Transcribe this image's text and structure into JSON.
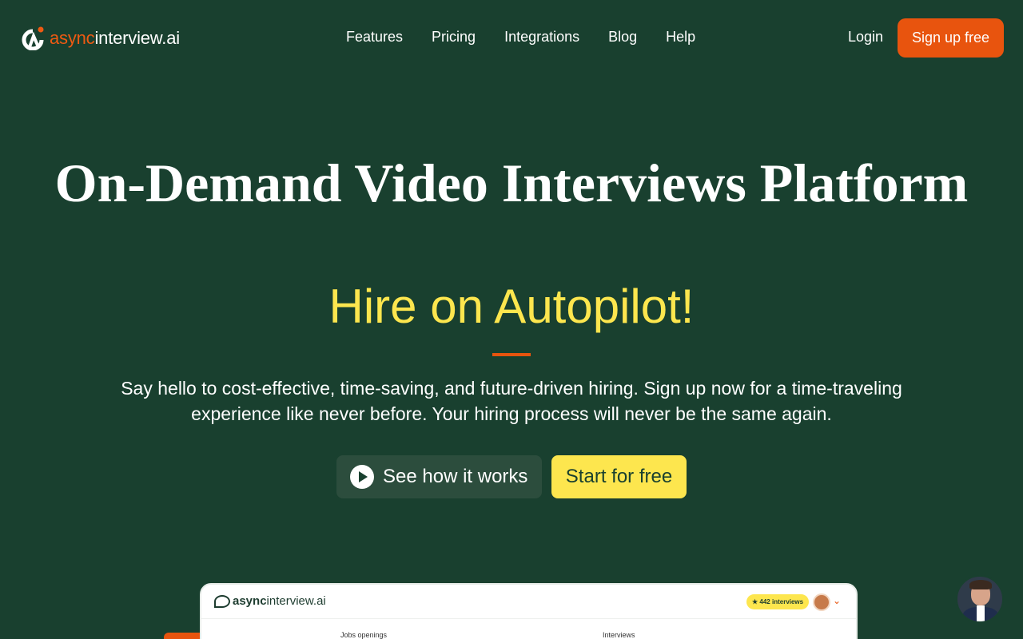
{
  "brand": {
    "part1": "async",
    "part2": "interview.ai"
  },
  "nav": {
    "links": [
      "Features",
      "Pricing",
      "Integrations",
      "Blog",
      "Help"
    ],
    "login": "Login",
    "signup": "Sign up free"
  },
  "hero": {
    "title": "On-Demand Video Interviews Platform",
    "subtitle": "Hire on Autopilot!",
    "description": "Say hello to cost-effective, time-saving, and future-driven hiring. Sign up now for a time-traveling experience like never before. Your hiring process will never be the same again.",
    "btn_how": "See how it works",
    "btn_start": "Start for free"
  },
  "preview": {
    "logo_part1": "async",
    "logo_part2": "interview.ai",
    "badge": "442 interviews",
    "col_jobs": "Jobs openings",
    "col_interviews": "Interviews"
  },
  "colors": {
    "bg": "#19402f",
    "accent": "#e8540e",
    "highlight": "#fde64e"
  }
}
